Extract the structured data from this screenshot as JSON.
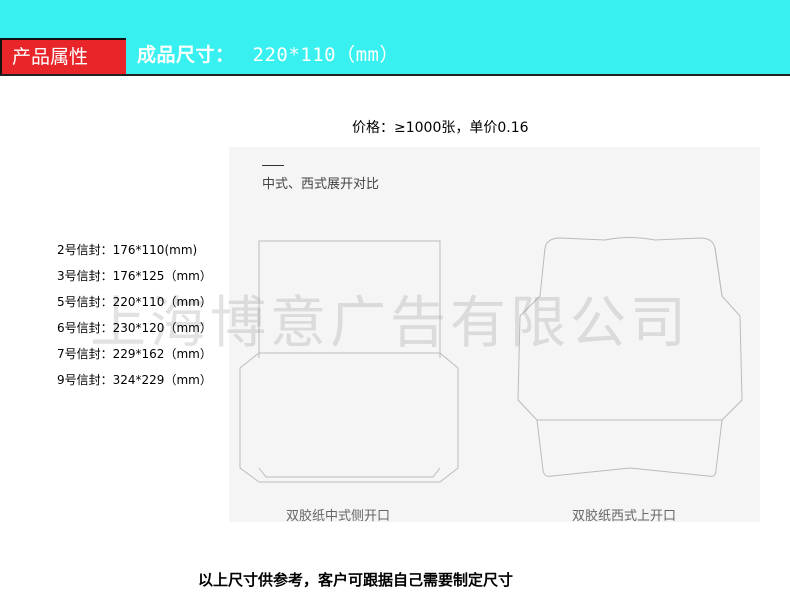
{
  "header": {
    "tag_label": "产品属性",
    "size_label": "成品尺寸：",
    "size_value": "220*110（mm）"
  },
  "price_text": "价格：≥1000张，单价0.16",
  "panel": {
    "title": "中式、西式展开对比",
    "caption_left": "双胶纸中式侧开口",
    "caption_right": "双胶纸西式上开口"
  },
  "watermark": "上海博意广告有限公司",
  "sizes": [
    "2号信封：176*110(mm)",
    "3号信封：176*125（mm）",
    "5号信封：220*110（mm）",
    "6号信封：230*120（mm）",
    "7号信封：229*162（mm）",
    "9号信封：324*229（mm）"
  ],
  "note": "以上尺寸供参考，客户可跟据自己需要制定尺寸",
  "colors": {
    "banner": "#38f0f0",
    "tag": "#e8262a",
    "panel": "#f5f5f5"
  }
}
